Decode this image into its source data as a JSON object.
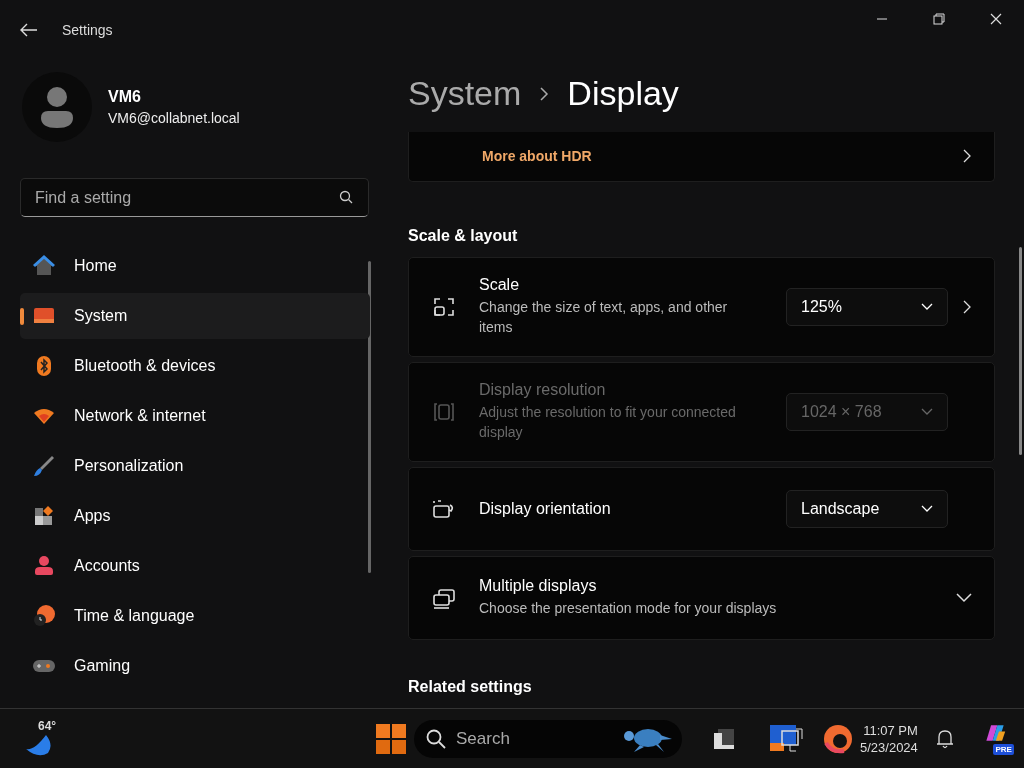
{
  "window": {
    "title": "Settings"
  },
  "user": {
    "name": "VM6",
    "email": "VM6@collabnet.local"
  },
  "search": {
    "placeholder": "Find a setting"
  },
  "nav": [
    {
      "label": "Home",
      "selected": false
    },
    {
      "label": "System",
      "selected": true
    },
    {
      "label": "Bluetooth & devices",
      "selected": false
    },
    {
      "label": "Network & internet",
      "selected": false
    },
    {
      "label": "Personalization",
      "selected": false
    },
    {
      "label": "Apps",
      "selected": false
    },
    {
      "label": "Accounts",
      "selected": false
    },
    {
      "label": "Time & language",
      "selected": false
    },
    {
      "label": "Gaming",
      "selected": false
    }
  ],
  "breadcrumb": [
    {
      "label": "System"
    },
    {
      "label": "Display"
    }
  ],
  "hdr_card": {
    "link": "More about HDR"
  },
  "section": {
    "heading": "Scale & layout",
    "items": [
      {
        "kind": "dropdown",
        "title": "Scale",
        "description": "Change the size of text, apps, and other items",
        "value": "125%",
        "link": true,
        "disabled": false
      },
      {
        "kind": "dropdown",
        "title": "Display resolution",
        "description": "Adjust the resolution to fit your connected display",
        "value": "1024 × 768",
        "link": false,
        "disabled": true
      },
      {
        "kind": "dropdown",
        "title": "Display orientation",
        "value": "Landscape",
        "link": false,
        "disabled": false
      },
      {
        "kind": "expander",
        "title": "Multiple displays",
        "description": "Choose the presentation mode for your displays",
        "expanded": false,
        "disabled": false
      }
    ]
  },
  "related_heading": "Related settings",
  "taskbar": {
    "temperature": "64°",
    "search_placeholder": "Search",
    "time": "11:07 PM",
    "date": "5/23/2024",
    "badge": "PRE"
  }
}
